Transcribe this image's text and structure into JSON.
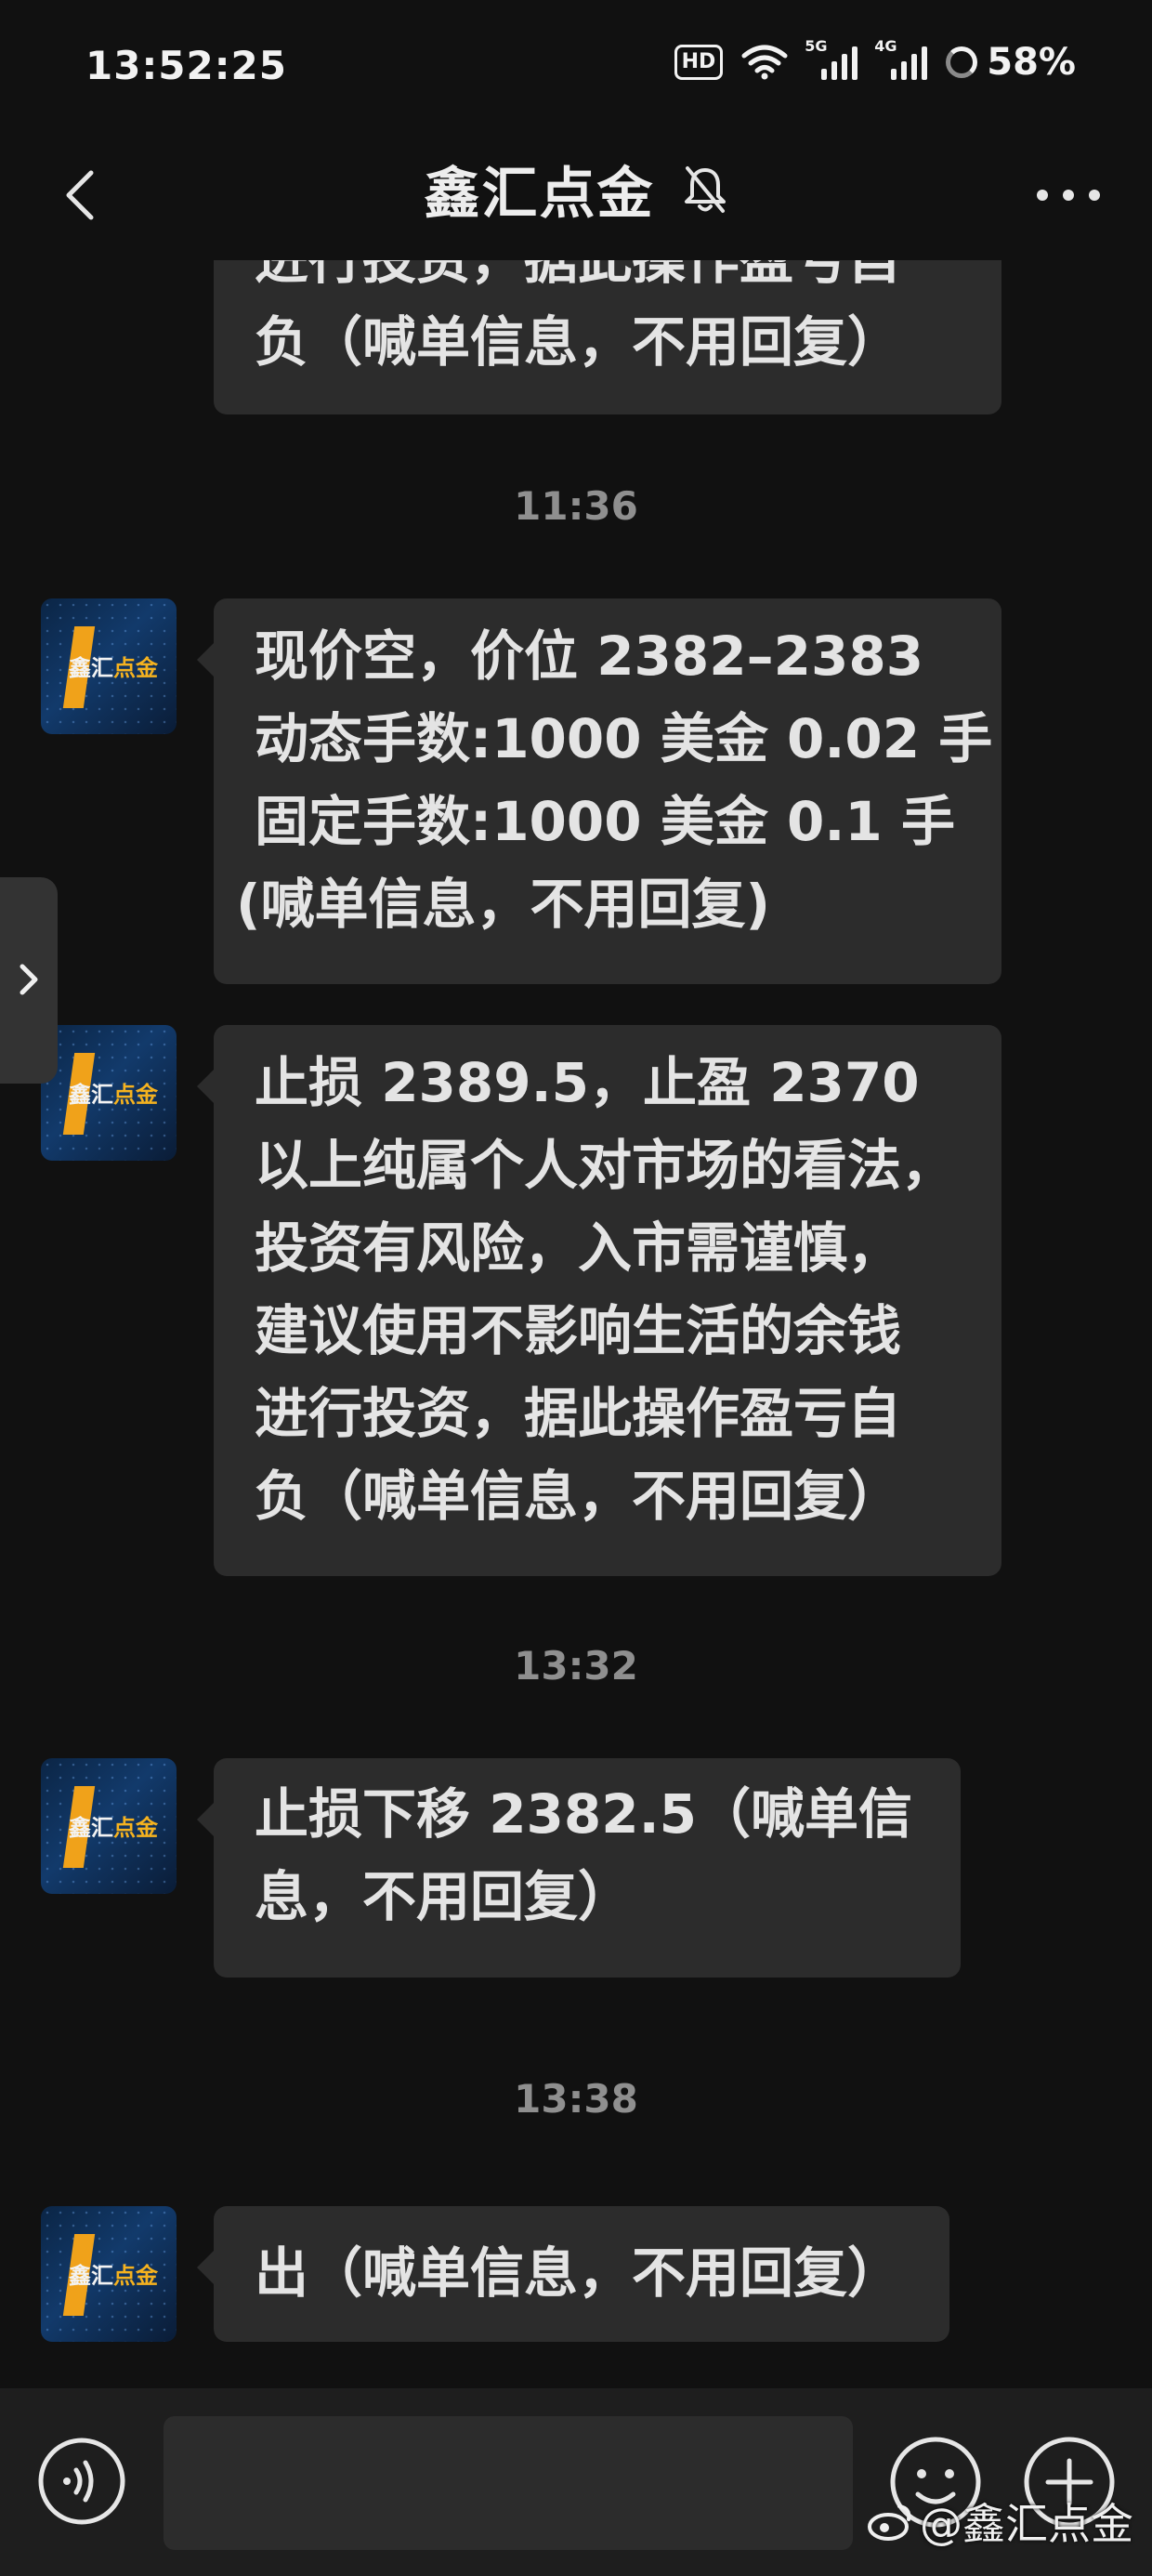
{
  "status_bar": {
    "time": "13:52:25",
    "hd_label": "HD",
    "net1": "5G",
    "net2": "4G",
    "battery": "58%"
  },
  "header": {
    "title": "鑫汇点金",
    "icons": [
      "back-icon",
      "mute-bell-icon",
      "more-icon"
    ]
  },
  "avatar": {
    "label_a": "鑫汇",
    "label_b": "点金"
  },
  "messages": [
    {
      "lines": [
        "进行投资，据此操作盈亏自",
        "负（喊单信息，不用回复）"
      ]
    },
    {
      "time": "11:36",
      "lines": [
        "现价空，价位 2382–2383",
        "动态手数:1000 美金 0.02 手",
        "固定手数:1000 美金 0.1 手",
        "(喊单信息，不用回复)"
      ]
    },
    {
      "lines": [
        "止损 2389.5，止盈 2370",
        "以上纯属个人对市场的看法，",
        "投资有风险，入市需谨慎，",
        "建议使用不影响生活的余钱",
        "进行投资，据此操作盈亏自",
        "负（喊单信息，不用回复）"
      ]
    },
    {
      "time": "13:32",
      "lines": [
        "止损下移 2382.5（喊单信",
        "息，不用回复）"
      ]
    },
    {
      "time": "13:38",
      "lines": [
        "出（喊单信息，不用回复）"
      ]
    }
  ],
  "input": {
    "placeholder": ""
  },
  "watermark": {
    "text": "@鑫汇点金"
  },
  "colors": {
    "background": "#111111",
    "bubble": "#2c2c2c",
    "text": "#e4e4e4",
    "timestamp": "#8f8f8f",
    "accent": "#f0a21a"
  }
}
